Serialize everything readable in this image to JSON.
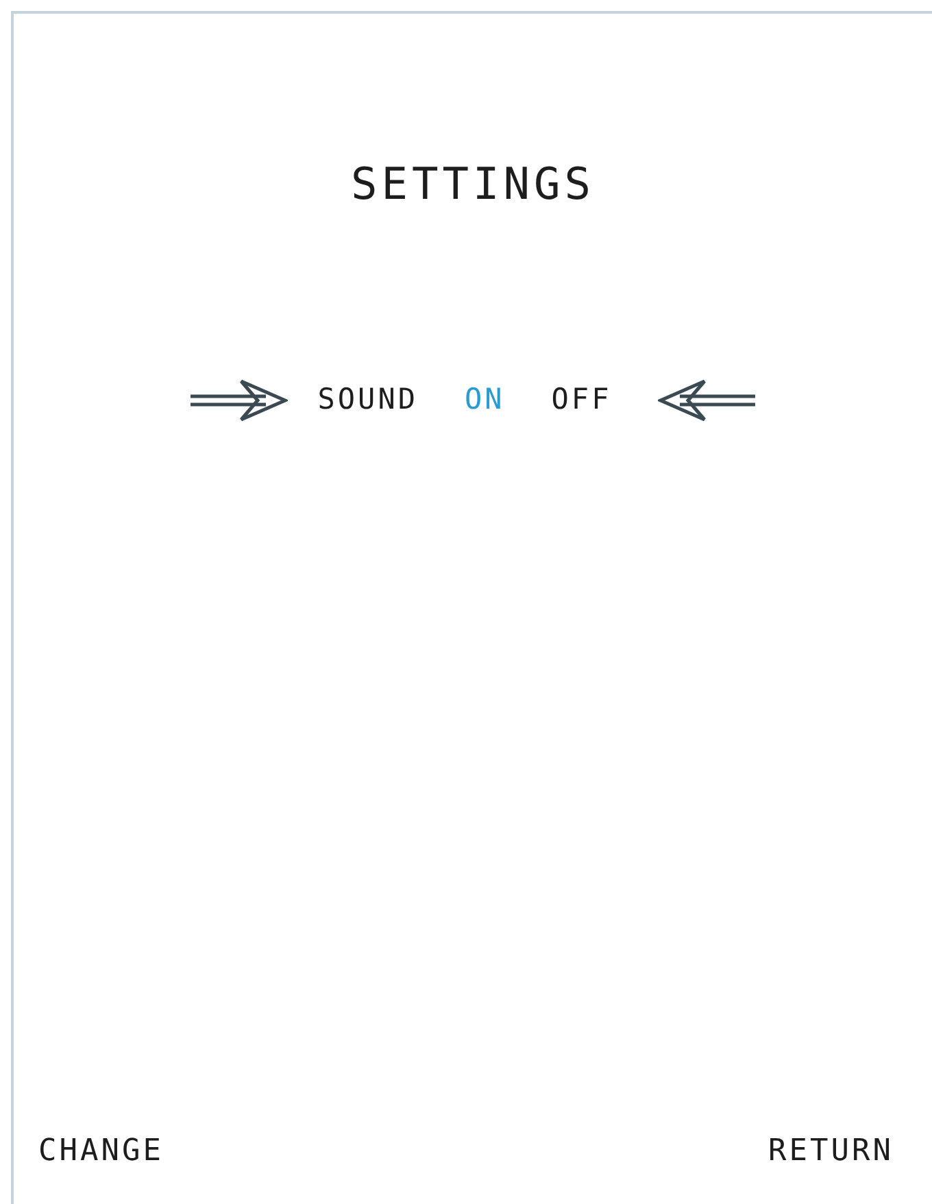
{
  "title": "SETTINGS",
  "option": {
    "label": "SOUND",
    "choices": [
      {
        "label": "ON",
        "selected": true
      },
      {
        "label": "OFF",
        "selected": false
      }
    ]
  },
  "softkeys": {
    "left": "CHANGE",
    "right": "RETURN"
  }
}
